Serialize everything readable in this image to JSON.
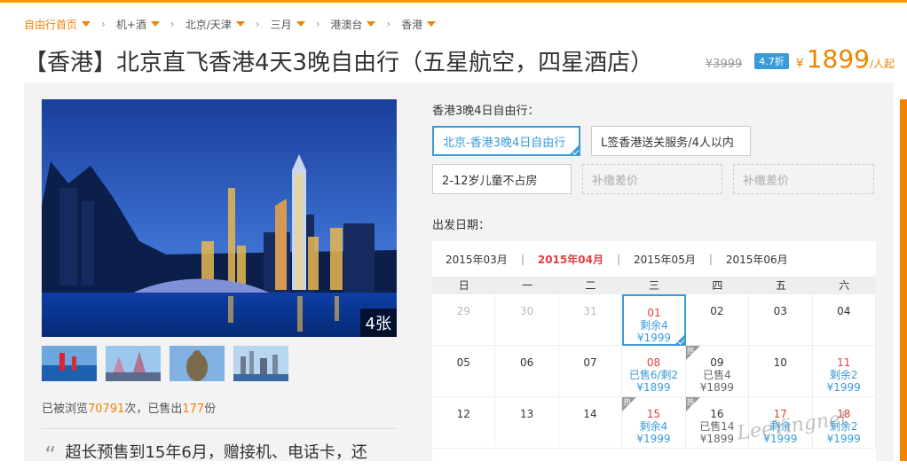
{
  "breadcrumb": [
    {
      "label": "自由行首页",
      "dropdown": true
    },
    {
      "label": "机+酒",
      "dropdown": true
    },
    {
      "label": "北京/天津",
      "dropdown": true
    },
    {
      "label": "三月",
      "dropdown": true
    },
    {
      "label": "港澳台",
      "dropdown": true
    },
    {
      "label": "香港",
      "dropdown": true
    }
  ],
  "product": {
    "title": "【香港】北京直飞香港4天3晚自由行（五星航空，四星酒店）",
    "old_price": "¥3999",
    "discount": "4.7折",
    "currency": "¥",
    "price": "1899",
    "unit": "/人起"
  },
  "gallery": {
    "photo_count": "4张",
    "thumbnails": [
      "thumb-1",
      "thumb-2",
      "thumb-3",
      "thumb-4"
    ]
  },
  "stats": {
    "prefix": "已被浏览",
    "views": "70791",
    "middle": "次，已售出",
    "sold": "177",
    "suffix": "份"
  },
  "quote": {
    "text": "超长预售到15年6月，赠接机、电话卡，还"
  },
  "package": {
    "label": "香港3晚4日自由行：",
    "options": [
      {
        "label": "北京-香港3晚4日自由行",
        "selected": true
      },
      {
        "label": "L签香港送关服务/4人以内",
        "selected": false
      },
      {
        "label": "2-12岁儿童不占房",
        "selected": false
      },
      {
        "label": "补缴差价",
        "selected": false,
        "dashed": true
      },
      {
        "label": "补缴差价",
        "selected": false,
        "dashed": true
      }
    ]
  },
  "departure": {
    "label": "出发日期：",
    "months": [
      "2015年03月",
      "2015年04月",
      "2015年05月",
      "2015年06月"
    ],
    "active_month": "2015年04月",
    "weekdays": [
      "日",
      "一",
      "二",
      "三",
      "四",
      "五",
      "六"
    ],
    "rows": [
      [
        {
          "d": "29",
          "past": true
        },
        {
          "d": "30",
          "past": true
        },
        {
          "d": "31",
          "past": true
        },
        {
          "d": "01",
          "l1": "剩余4",
          "l2": "¥1999",
          "sel": true,
          "red": true
        },
        {
          "d": "02"
        },
        {
          "d": "03"
        },
        {
          "d": "04"
        }
      ],
      [
        {
          "d": "05"
        },
        {
          "d": "06"
        },
        {
          "d": "07"
        },
        {
          "d": "08",
          "l1": "已售6/剩2",
          "l2": "¥1899",
          "red": true
        },
        {
          "d": "09",
          "l1": "已售4",
          "l2": "¥1899",
          "tag": "热",
          "gray": true
        },
        {
          "d": "10"
        },
        {
          "d": "11",
          "l1": "剩余2",
          "l2": "¥1999",
          "red": true
        }
      ],
      [
        {
          "d": "12"
        },
        {
          "d": "13"
        },
        {
          "d": "14"
        },
        {
          "d": "15",
          "l1": "剩余4",
          "l2": "¥1999",
          "tag": "热",
          "red": true
        },
        {
          "d": "16",
          "l1": "已售14",
          "l2": "¥1899",
          "tag": "热",
          "gray": true
        },
        {
          "d": "17",
          "l1": "剩余",
          "l2": "¥1999",
          "red": true
        },
        {
          "d": "18",
          "l1": "剩余2",
          "l2": "¥1999",
          "red": true
        }
      ]
    ]
  },
  "watermark": "LeeYingnet"
}
